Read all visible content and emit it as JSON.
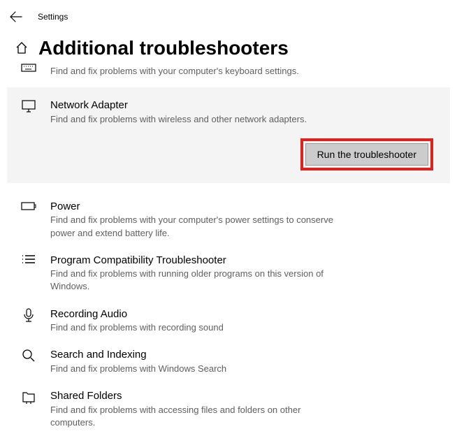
{
  "header": {
    "title": "Settings"
  },
  "page": {
    "title": "Additional troubleshooters"
  },
  "keyboard": {
    "desc": "Find and fix problems with your computer's keyboard settings."
  },
  "items": {
    "network": {
      "title": "Network Adapter",
      "desc": "Find and fix problems with wireless and other network adapters.",
      "run_label": "Run the troubleshooter"
    },
    "power": {
      "title": "Power",
      "desc": "Find and fix problems with your computer's power settings to conserve power and extend battery life."
    },
    "compat": {
      "title": "Program Compatibility Troubleshooter",
      "desc": "Find and fix problems with running older programs on this version of Windows."
    },
    "recording": {
      "title": "Recording Audio",
      "desc": "Find and fix problems with recording sound"
    },
    "search": {
      "title": "Search and Indexing",
      "desc": "Find and fix problems with Windows Search"
    },
    "shared": {
      "title": "Shared Folders",
      "desc": "Find and fix problems with accessing files and folders on other computers."
    }
  }
}
